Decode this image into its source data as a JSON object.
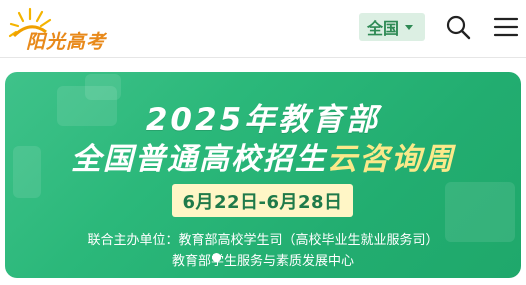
{
  "header": {
    "logo_text": "阳光高考",
    "region_label": "全国",
    "icons": [
      "sun-icon",
      "chevron-down-icon",
      "search-icon",
      "menu-icon"
    ]
  },
  "banner": {
    "line1": "2025年教育部",
    "line2_white": "全国普通高校招生",
    "line2_yellow": "云咨询周",
    "dates": "6月22日-6月28日",
    "organizers_line1": "联合主办单位：教育部高校学生司（高校毕业生就业服务司）",
    "organizers_line2": "教育部学生服务与素质发展中心",
    "colors": {
      "green": "#2bb87a",
      "yellow_text": "#fbe98a",
      "date_bg": "#fff6c6"
    }
  }
}
